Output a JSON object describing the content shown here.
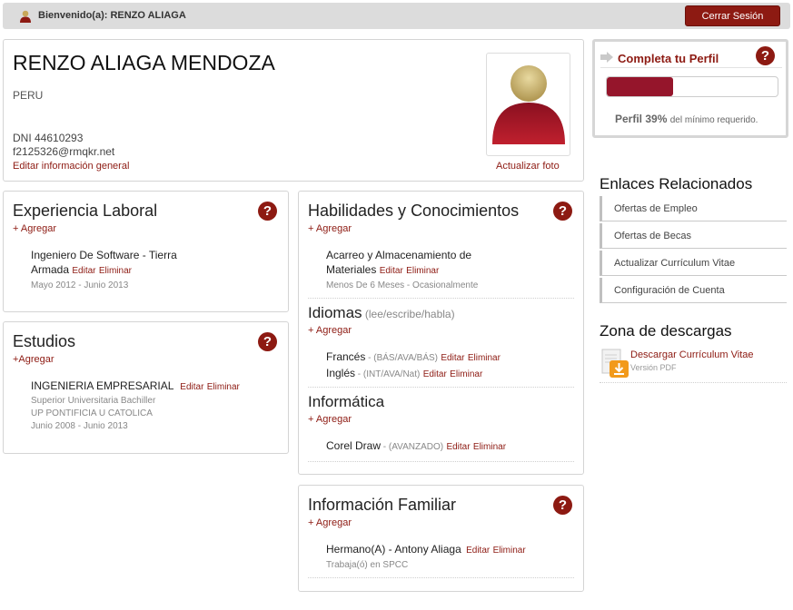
{
  "header": {
    "welcome": "Bienvenido(a): RENZO ALIAGA",
    "logout_label": "Cerrar Sesión"
  },
  "profile": {
    "name": "RENZO ALIAGA MENDOZA",
    "country": "PERU",
    "dni": "DNI 44610293",
    "email": "f2125326@rmqkr.net",
    "edit_general": "Editar información general",
    "update_photo": "Actualizar foto"
  },
  "experience": {
    "title": "Experiencia Laboral",
    "add": "+ Agregar",
    "entry_line1": "Ingeniero De Software - Tierra",
    "entry_line2": "Armada",
    "edit": "Editar",
    "delete": "Eliminar",
    "dates": "Mayo 2012 - Junio 2013"
  },
  "studies": {
    "title": "Estudios",
    "add": "+Agregar",
    "degree": "INGENIERIA EMPRESARIAL",
    "edit": "Editar",
    "delete": "Eliminar",
    "level": "Superior Universitaria Bachiller",
    "school": "UP PONTIFICIA U CATOLICA",
    "dates": "Junio 2008 - Junio 2013"
  },
  "skills": {
    "title": "Habilidades y Conocimientos",
    "add": "+ Agregar",
    "entry_line1": "Acarreo y Almacenamiento de",
    "entry_line2": "Materiales",
    "edit": "Editar",
    "delete": "Eliminar",
    "duration": "Menos De 6 Meses - Ocasionalmente"
  },
  "languages": {
    "title": "Idiomas",
    "subtitle": "(lee/escribe/habla)",
    "add": "+ Agregar",
    "items": [
      {
        "name": "Francés",
        "level": " - (BÁS/AVA/BÁS)",
        "edit": "Editar",
        "delete": "Eliminar"
      },
      {
        "name": "Inglés",
        "level": " - (INT/AVA/Nat)",
        "edit": "Editar",
        "delete": "Eliminar"
      }
    ]
  },
  "computing": {
    "title": "Informática",
    "add": "+ Agregar",
    "name": "Corel Draw",
    "level": " - (AVANZADO)",
    "edit": "Editar",
    "delete": "Eliminar"
  },
  "family": {
    "title": "Información Familiar",
    "add": "+ Agregar",
    "entry": "Hermano(A) - Antony Aliaga",
    "edit": "Editar",
    "delete": "Eliminar",
    "work": "Trabaja(ó) en SPCC"
  },
  "complete_profile": {
    "title": "Completa tu Perfil",
    "progress": 0.39,
    "label_prefix": "Perfil",
    "percent": "39%",
    "suffix": "del mínimo requerido."
  },
  "related": {
    "title": "Enlaces Relacionados",
    "items": [
      "Ofertas de Empleo",
      "Ofertas de Becas",
      "Actualizar Currículum Vitae",
      "Configuración de Cuenta"
    ]
  },
  "downloads": {
    "title": "Zona de descargas",
    "link": "Descargar Currículum Vitae",
    "version": "Versión PDF"
  },
  "icons": {
    "help": "?",
    "colors": {
      "accent": "#8d1a12",
      "progress": "#95152b"
    }
  }
}
